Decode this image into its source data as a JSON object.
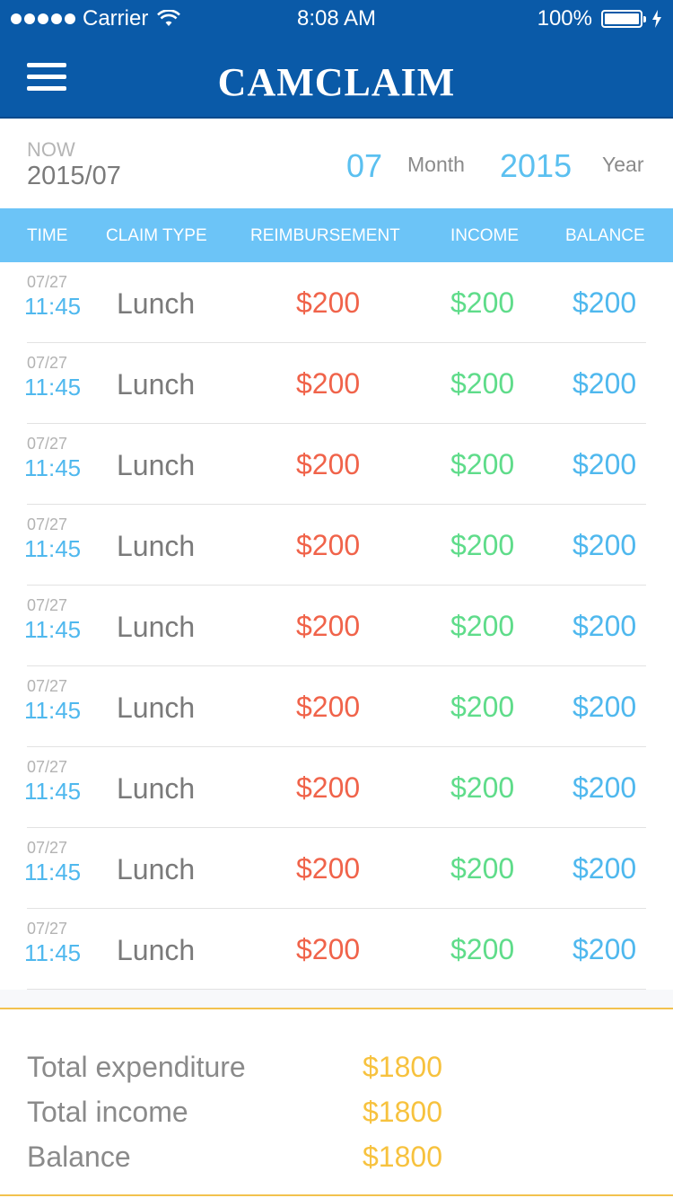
{
  "status_bar": {
    "carrier": "Carrier",
    "time": "8:08 AM",
    "battery": "100%"
  },
  "nav": {
    "logo": "CAMCLAIM"
  },
  "date_header": {
    "now_label": "NOW",
    "now_value": "2015/07",
    "month_value": "07",
    "month_label": "Month",
    "year_value": "2015",
    "year_label": "Year"
  },
  "table": {
    "headers": {
      "time": "TIME",
      "claim_type": "CLAIM TYPE",
      "reimbursement": "REIMBURSEMENT",
      "income": "INCOME",
      "balance": "BALANCE"
    },
    "rows": [
      {
        "date": "07/27",
        "time": "11:45",
        "type": "Lunch",
        "reimbursement": "$200",
        "income": "$200",
        "balance": "$200"
      },
      {
        "date": "07/27",
        "time": "11:45",
        "type": "Lunch",
        "reimbursement": "$200",
        "income": "$200",
        "balance": "$200"
      },
      {
        "date": "07/27",
        "time": "11:45",
        "type": "Lunch",
        "reimbursement": "$200",
        "income": "$200",
        "balance": "$200"
      },
      {
        "date": "07/27",
        "time": "11:45",
        "type": "Lunch",
        "reimbursement": "$200",
        "income": "$200",
        "balance": "$200"
      },
      {
        "date": "07/27",
        "time": "11:45",
        "type": "Lunch",
        "reimbursement": "$200",
        "income": "$200",
        "balance": "$200"
      },
      {
        "date": "07/27",
        "time": "11:45",
        "type": "Lunch",
        "reimbursement": "$200",
        "income": "$200",
        "balance": "$200"
      },
      {
        "date": "07/27",
        "time": "11:45",
        "type": "Lunch",
        "reimbursement": "$200",
        "income": "$200",
        "balance": "$200"
      },
      {
        "date": "07/27",
        "time": "11:45",
        "type": "Lunch",
        "reimbursement": "$200",
        "income": "$200",
        "balance": "$200"
      },
      {
        "date": "07/27",
        "time": "11:45",
        "type": "Lunch",
        "reimbursement": "$200",
        "income": "$200",
        "balance": "$200"
      }
    ]
  },
  "summary": {
    "total_expenditure_label": "Total expenditure",
    "total_expenditure_value": "$1800",
    "total_income_label": "Total income",
    "total_income_value": "$1800",
    "balance_label": "Balance",
    "balance_value": "$1800"
  },
  "colors": {
    "brand_blue": "#0a5aa8",
    "header_blue": "#6cc4f7",
    "reimbursement_red": "#f0634a",
    "income_green": "#5fdc8a",
    "balance_blue": "#4fb8ee",
    "total_gold": "#f7c23e"
  },
  "icons": [
    "signal-icon",
    "wifi-icon",
    "battery-icon",
    "charging-bolt-icon",
    "menu-icon"
  ]
}
